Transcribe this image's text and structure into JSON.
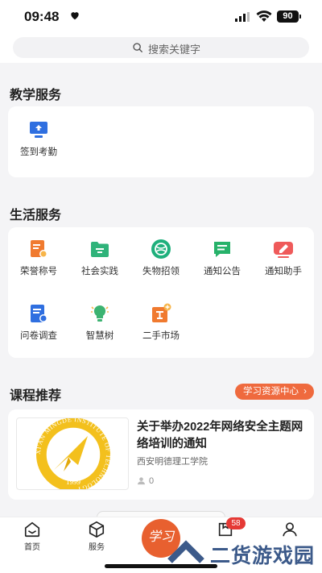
{
  "status_bar": {
    "time": "09:48",
    "battery": "90"
  },
  "search": {
    "placeholder": "搜索关键字"
  },
  "teaching": {
    "title": "教学服务",
    "items": [
      {
        "label": "签到考勤",
        "icon": "attendance-icon"
      }
    ]
  },
  "life": {
    "title": "生活服务",
    "items": [
      {
        "label": "荣誉称号",
        "icon": "honor-icon",
        "color": "#f07a2f"
      },
      {
        "label": "社会实践",
        "icon": "practice-folder-icon",
        "color": "#2fb37a"
      },
      {
        "label": "失物招领",
        "icon": "lost-found-icon",
        "color": "#1fb07c"
      },
      {
        "label": "通知公告",
        "icon": "notice-icon",
        "color": "#27b26a"
      },
      {
        "label": "通知助手",
        "icon": "notify-assistant-icon",
        "color": "#ef5a5a"
      },
      {
        "label": "问卷调查",
        "icon": "survey-icon",
        "color": "#2f6fe0"
      },
      {
        "label": "智慧树",
        "icon": "wisdom-tree-icon",
        "color": "#3cb371"
      },
      {
        "label": "二手市场",
        "icon": "second-hand-market-icon",
        "color": "#f07a2f"
      }
    ]
  },
  "courses": {
    "title": "课程推荐",
    "resource_button": "学习资源中心",
    "items": [
      {
        "title": "关于举办2022年网络安全主题网络培训的通知",
        "org": "西安明德理工学院",
        "views": "0",
        "logo_text": "XI'AN MINGDE INSTITUTE OF TECHNOLOGY",
        "logo_year": "1999"
      }
    ]
  },
  "tabbar": {
    "tabs": [
      {
        "label": "首页",
        "icon": "home-icon"
      },
      {
        "label": "服务",
        "icon": "services-cube-icon"
      },
      {
        "label": "",
        "icon": "study-center-icon"
      },
      {
        "label": "",
        "icon": "messages-icon"
      },
      {
        "label": "",
        "icon": "profile-icon"
      }
    ],
    "center_text": "学习",
    "message_badge": "58"
  },
  "watermark": {
    "text": "二货游戏园"
  },
  "colors": {
    "accent": "#ef6a3e",
    "badge": "#e53935",
    "primary_blue": "#2f6fe0"
  }
}
